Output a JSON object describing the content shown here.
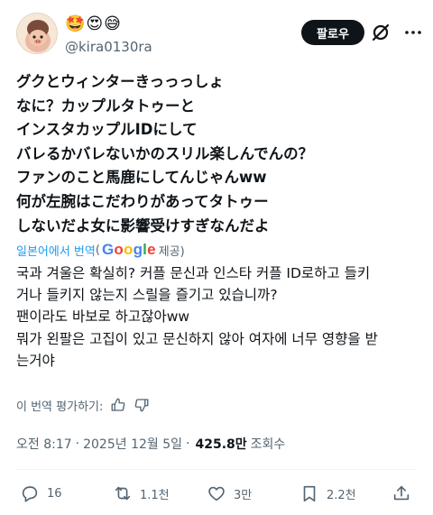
{
  "author": {
    "emoji": "🤩😍😅",
    "handle": "@kira0130ra"
  },
  "header": {
    "follow_label": "팔로우",
    "icons": [
      "grok-icon",
      "more-icon"
    ]
  },
  "post": {
    "original_lines": [
      "グクとウィンターきっっっしょ",
      "なに？カップルタトゥーと",
      "インスタカップルIDにして",
      "バレるかバレないかのスリル楽しんでんの？",
      "ファンのこと馬鹿にしてんじゃんww",
      "何が左腕はこだわりがあってタトゥー",
      "しないだよ女に影響受けすぎなんだよ"
    ],
    "translation": {
      "label": "일본어에서 번역",
      "open_paren": "(",
      "provider": "Google",
      "provided": "제공)"
    },
    "translated_lines": [
      "국과 겨울은 확실히? 커플 문신과 인스타 커플 ID로하고 들키",
      "거나 들키지 않는지 스릴을 즐기고 있습니까?",
      "팬이라도 바보로 하고잖아ww",
      "뭐가 왼팔은 고집이 있고 문신하지 않아 여자에 너무 영향을 받",
      "는거야"
    ],
    "rate_label": "이 번역 평가하기:"
  },
  "meta": {
    "time": "오전 8:17",
    "sep1": "·",
    "date": "2025년 12월 5일",
    "sep2": "·",
    "views": "425.8만",
    "views_label": "조회수"
  },
  "actions": {
    "replies": "16",
    "reposts": "1.1천",
    "likes": "3만",
    "bookmarks": "2.2천"
  },
  "colors": {
    "accent": "#1d9bf0",
    "text": "#0f1419",
    "muted": "#536471",
    "follow_bg": "#0f1419"
  }
}
